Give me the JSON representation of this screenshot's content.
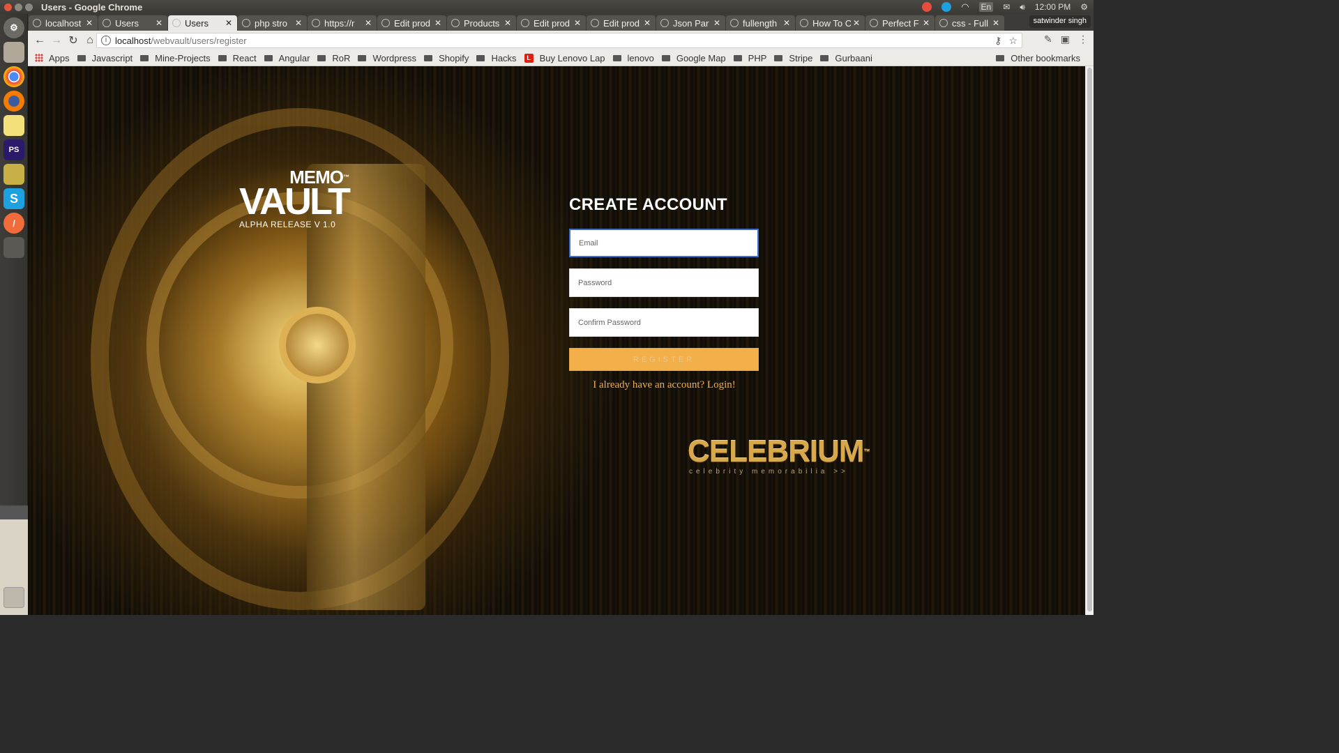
{
  "os": {
    "window_title": "Users - Google Chrome",
    "clock": "12:00 PM",
    "keyboard": "En"
  },
  "launcher": {
    "items": [
      "system-settings",
      "files",
      "chrome",
      "firefox",
      "notes",
      "phpstorm",
      "gimp",
      "skype",
      "postman",
      "manager"
    ]
  },
  "tabs": [
    {
      "label": "localhost",
      "active": false
    },
    {
      "label": "Users",
      "active": false
    },
    {
      "label": "Users",
      "active": true
    },
    {
      "label": "php stro",
      "active": false
    },
    {
      "label": "https://r",
      "active": false
    },
    {
      "label": "Edit prod",
      "active": false
    },
    {
      "label": "Products",
      "active": false
    },
    {
      "label": "Edit prod",
      "active": false
    },
    {
      "label": "Edit prod",
      "active": false
    },
    {
      "label": "Json Par",
      "active": false
    },
    {
      "label": "fullength",
      "active": false
    },
    {
      "label": "How To C",
      "active": false
    },
    {
      "label": "Perfect F",
      "active": false
    },
    {
      "label": "css - Full",
      "active": false
    }
  ],
  "profile": "satwinder singh",
  "address": {
    "host": "localhost",
    "path": "/webvault/users/register"
  },
  "bookmarks": {
    "apps_label": "Apps",
    "items": [
      "Javascript",
      "Mine-Projects",
      "React",
      "Angular",
      "RoR",
      "Wordpress",
      "Shopify",
      "Hacks",
      "Buy Lenovo Lap",
      "lenovo",
      "Google Map",
      "PHP",
      "Stripe",
      "Gurbaani"
    ],
    "other": "Other bookmarks"
  },
  "logo": {
    "memo": "MEMO",
    "tm": "™",
    "vault": "VAULT",
    "release": "ALPHA RELEASE V 1.0"
  },
  "form": {
    "title": "CREATE ACCOUNT",
    "email_placeholder": "Email",
    "password_placeholder": "Password",
    "confirm_placeholder": "Confirm Password",
    "register_label": "REGISTER",
    "login_link": "I already have an account? Login!"
  },
  "brand": {
    "name": "CELEBRIUM",
    "tm": "™",
    "tagline": "celebrity memorabilia >>"
  },
  "colors": {
    "accent": "#f3b04a",
    "link": "#f0ae48",
    "brand_gold": "#d7a94c"
  }
}
